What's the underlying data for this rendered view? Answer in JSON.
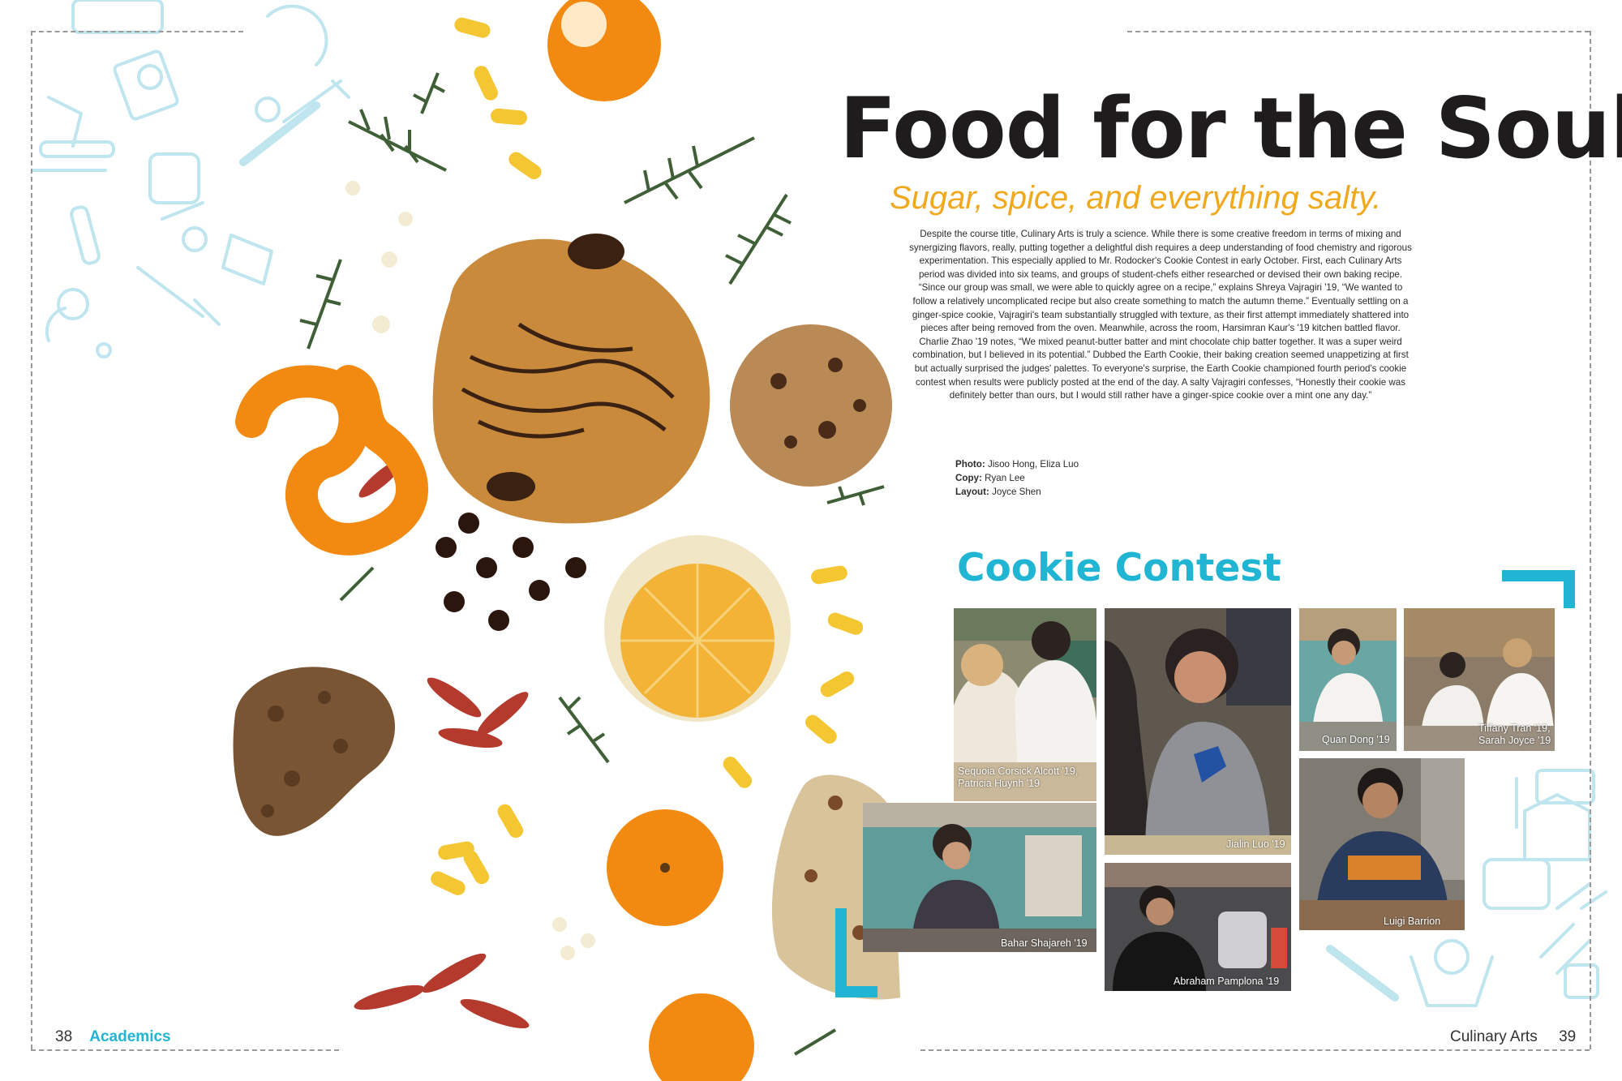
{
  "left_page": {
    "page_number": "38",
    "section": "Academics"
  },
  "right_page": {
    "page_number": "39",
    "running_head": "Culinary Arts"
  },
  "article": {
    "title": "Food for the Soul",
    "subtitle": "Sugar, spice, and everything salty.",
    "body": "Despite the course title, Culinary Arts is truly a science. While there is some creative freedom in terms of mixing and synergizing flavors, really, putting together a delightful dish requires a deep understanding of food chemistry and rigorous experimentation. This especially applied to Mr. Rodocker's Cookie Contest in early October. First, each Culinary Arts period was divided into six teams, and groups of student-chefs either researched or devised their own baking recipe. “Since our group was small, we were able to quickly agree on a recipe,” explains Shreya Vajragiri '19, “We wanted to follow a relatively uncomplicated recipe but also create something to match the autumn theme.” Eventually settling on a ginger-spice cookie, Vajragiri's team substantially struggled with texture, as their first attempt immediately shattered into pieces after being removed from the oven. Meanwhile, across the room, Harsimran Kaur's '19 kitchen battled flavor. Charlie Zhao '19 notes, “We mixed peanut-butter batter and mint chocolate chip batter together. It was a super weird combination, but I believed in its potential.” Dubbed the Earth Cookie, their baking creation seemed unappetizing at first but actually surprised the judges' palettes. To everyone's surprise, the Earth Cookie championed fourth period's cookie contest when results were publicly posted at the end of the day. A salty Vajragiri confesses, “Honestly their cookie was definitely better than ours, but I would still rather have a ginger-spice cookie over a mint one any day.”",
    "credits": [
      {
        "label": "Photo:",
        "value": "Jisoo Hong, Eliza Luo"
      },
      {
        "label": "Copy:",
        "value": "Ryan Lee"
      },
      {
        "label": "Layout:",
        "value": "Joyce Shen"
      }
    ]
  },
  "sidebar": {
    "title": "Cookie Contest",
    "photos": [
      {
        "caption_1": "Sequoia Corsick Alcott '19,",
        "caption_2": "Patricia Huynh '19"
      },
      {
        "caption_1": "Jialin Luo '19"
      },
      {
        "caption_1": "Quan Dong '19"
      },
      {
        "caption_1": "Tiffany Tran '19,",
        "caption_2": "Sarah Joyce '19"
      },
      {
        "caption_1": "Bahar Shajareh '19"
      },
      {
        "caption_1": "Luigi Barrion"
      },
      {
        "caption_1": "Abraham Pamplona '19"
      }
    ]
  },
  "colors": {
    "accent_cyan": "#1fb5d3",
    "accent_orange": "#f0a81d",
    "title_black": "#1e1c1d"
  }
}
